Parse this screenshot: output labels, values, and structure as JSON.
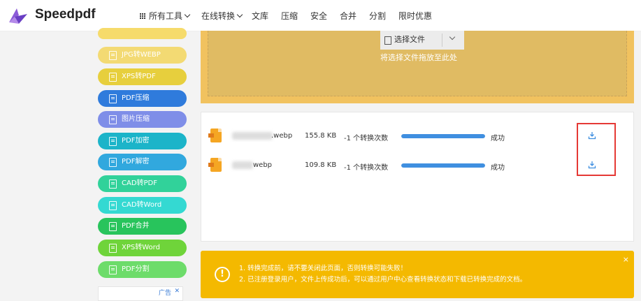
{
  "brand": {
    "name": "Speedpdf",
    "logo_icon": "logo-icon"
  },
  "nav": {
    "all_tools": "所有工具",
    "online_convert": "在线转换",
    "library": "文库",
    "compress": "压缩",
    "security": "安全",
    "merge": "合并",
    "split": "分割",
    "promo": "限时优惠"
  },
  "sidebar": {
    "items": [
      {
        "label": "",
        "color": "#f6db6b"
      },
      {
        "label": "JPG转WEBP",
        "color": "#f3da73"
      },
      {
        "label": "XPS转PDF",
        "color": "#e7cf3d"
      },
      {
        "label": "PDF压缩",
        "color": "#2f7bdc"
      },
      {
        "label": "图片压缩",
        "color": "#7f8ee8"
      },
      {
        "label": "PDF加密",
        "color": "#1cb4c9"
      },
      {
        "label": "PDF解密",
        "color": "#31a8de"
      },
      {
        "label": "CAD转PDF",
        "color": "#31d29a"
      },
      {
        "label": "CAD转Word",
        "color": "#34d9d2"
      },
      {
        "label": "PDF合并",
        "color": "#28c45c"
      },
      {
        "label": "XPS转Word",
        "color": "#6fd43a"
      },
      {
        "label": "PDF分割",
        "color": "#6ddc6a"
      }
    ]
  },
  "ad": {
    "label": "广告",
    "close": "✕"
  },
  "upload": {
    "select_label": "选择文件",
    "drop_hint": "将选择文件拖放至此处"
  },
  "files": [
    {
      "name": ".webp",
      "size": "155.8 KB",
      "count": "-1 个转换次数",
      "progress": 1.0,
      "status": "成功"
    },
    {
      "name": "webp",
      "size": "109.8 KB",
      "count": "-1 个转换次数",
      "progress": 1.0,
      "status": "成功"
    }
  ],
  "notice": {
    "icon": "!",
    "line1": "1. 转换完成前，请不要关闭此页面，否则转换可能失败！",
    "line2": "2. 已注册登录用户，文件上传成功后，可以通过用户中心查看转换状态和下载已转换完成的文档。",
    "close": "×"
  },
  "colors": {
    "accent": "#3f8fe0",
    "upload_bg": "#f1c25f",
    "notice_bg": "#f4b900",
    "highlight": "#e53935"
  }
}
